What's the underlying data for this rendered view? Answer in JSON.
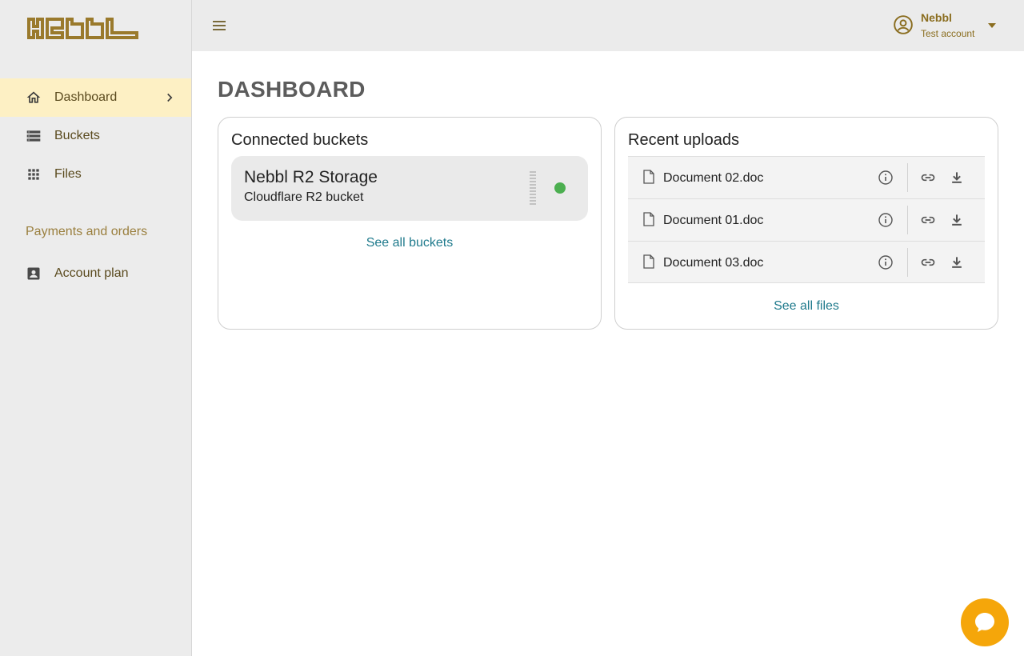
{
  "brand": {
    "name": "Nebbl",
    "color": "#9a7a2c"
  },
  "sidebar": {
    "items": [
      {
        "label": "Dashboard",
        "icon": "home-icon",
        "active": true
      },
      {
        "label": "Buckets",
        "icon": "storage-icon",
        "active": false
      },
      {
        "label": "Files",
        "icon": "grid-icon",
        "active": false
      }
    ],
    "section_label": "Payments and orders",
    "section_items": [
      {
        "label": "Account plan",
        "icon": "account-box-icon"
      }
    ]
  },
  "header": {
    "menu_icon": "menu-icon",
    "user": {
      "name": "Nebbl",
      "subtitle": "Test account",
      "icon": "account-circle-icon"
    }
  },
  "main": {
    "title": "DASHBOARD",
    "connected_buckets": {
      "title": "Connected buckets",
      "buckets": [
        {
          "name": "Nebbl R2 Storage",
          "type": "Cloudflare R2 bucket",
          "status_color": "#4caf50"
        }
      ],
      "see_all_label": "See all buckets"
    },
    "recent_uploads": {
      "title": "Recent uploads",
      "files": [
        {
          "name": "Document 02.doc"
        },
        {
          "name": "Document 01.doc"
        },
        {
          "name": "Document 03.doc"
        }
      ],
      "see_all_label": "See all files"
    }
  },
  "colors": {
    "accent": "#9a7a2c",
    "active_bg": "#fdf0c4",
    "link": "#1f7a8c",
    "chat": "#f5a60a",
    "status_ok": "#4caf50"
  },
  "chat_icon": "chat-bubble-icon"
}
